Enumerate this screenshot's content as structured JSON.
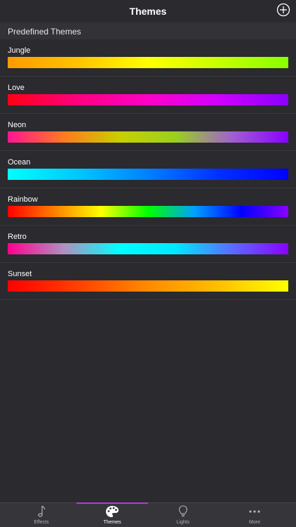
{
  "nav": {
    "title": "Themes",
    "add_icon": "plus-circle-icon"
  },
  "section": {
    "title": "Predefined Themes"
  },
  "themes": [
    {
      "name": "Jungle",
      "colors": [
        "#ff9a00",
        "#ffc400",
        "#ffff00",
        "#c8ff00",
        "#88ff00"
      ]
    },
    {
      "name": "Love",
      "colors": [
        "#ff0015",
        "#ff0080",
        "#ff00c8",
        "#d000ff",
        "#8a00ff"
      ]
    },
    {
      "name": "Neon",
      "colors": [
        "#ff1493",
        "#ff7a1f",
        "#c8d000",
        "#9ad020",
        "#a060d0",
        "#8a00ff"
      ]
    },
    {
      "name": "Ocean",
      "colors": [
        "#00ffff",
        "#00c8ff",
        "#0080ff",
        "#0030ff",
        "#0000ff"
      ]
    },
    {
      "name": "Rainbow",
      "colors": [
        "#ff0000",
        "#ff8000",
        "#ffff00",
        "#00ff00",
        "#00a0ff",
        "#0000ff",
        "#8a00ff"
      ]
    },
    {
      "name": "Retro",
      "colors": [
        "#ff0090",
        "#b090c0",
        "#00ffff",
        "#00e8ff",
        "#5a6cff",
        "#8a00ff"
      ]
    },
    {
      "name": "Sunset",
      "colors": [
        "#ff0000",
        "#ff4000",
        "#ff8a00",
        "#ffbf00",
        "#ffff00"
      ]
    }
  ],
  "tabs": [
    {
      "label": "Effects",
      "icon": "music-note-icon",
      "active": false
    },
    {
      "label": "Themes",
      "icon": "palette-icon",
      "active": true
    },
    {
      "label": "Lights",
      "icon": "lightbulb-icon",
      "active": false
    },
    {
      "label": "More",
      "icon": "ellipsis-icon",
      "active": false
    }
  ],
  "accent_color": "#b43cd8"
}
